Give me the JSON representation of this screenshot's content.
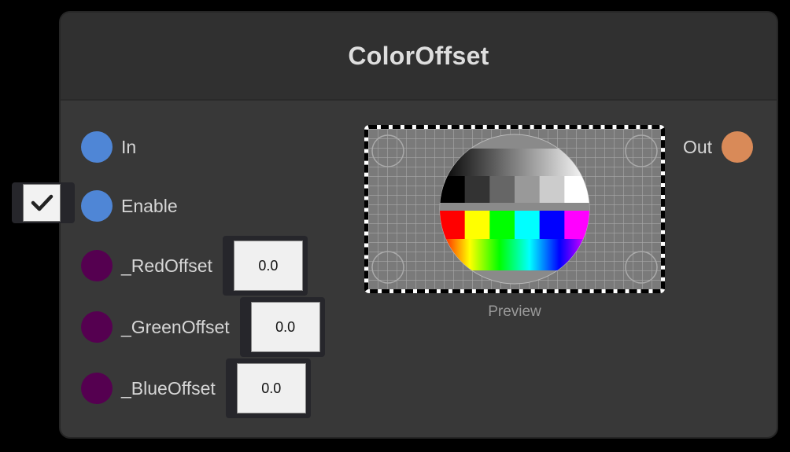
{
  "node": {
    "title": "ColorOffset"
  },
  "ports": {
    "inputs": [
      {
        "label": "In",
        "color": "#4f86d6"
      },
      {
        "label": "Enable",
        "color": "#4f86d6",
        "checked": true
      },
      {
        "label": "_RedOffset",
        "color": "#550050",
        "value": "0.0"
      },
      {
        "label": "_GreenOffset",
        "color": "#550050",
        "value": "0.0"
      },
      {
        "label": "_BlueOffset",
        "color": "#550050",
        "value": "0.0"
      }
    ],
    "output": {
      "label": "Out",
      "color": "#d98a58"
    }
  },
  "preview": {
    "caption": "Preview",
    "gray_steps": [
      "#000000",
      "#333333",
      "#666666",
      "#999999",
      "#cccccc",
      "#ffffff"
    ],
    "color_bars": [
      "#ff0000",
      "#ffff00",
      "#00ff00",
      "#00ffff",
      "#0000ff",
      "#ff00ff"
    ]
  }
}
